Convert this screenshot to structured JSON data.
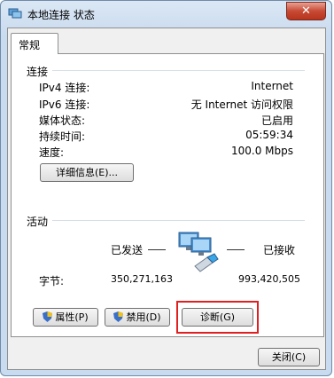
{
  "window": {
    "title": "本地连接 状态",
    "close_glyph": "✕"
  },
  "tabs": [
    {
      "label": "常规"
    }
  ],
  "connection": {
    "group_label": "连接",
    "rows": [
      {
        "label": "IPv4 连接:",
        "value": "Internet"
      },
      {
        "label": "IPv6 连接:",
        "value": "无 Internet 访问权限"
      },
      {
        "label": "媒体状态:",
        "value": "已启用"
      },
      {
        "label": "持续时间:",
        "value": "05:59:34"
      },
      {
        "label": "速度:",
        "value": "100.0 Mbps"
      }
    ],
    "details_button": "详细信息(E)..."
  },
  "activity": {
    "group_label": "活动",
    "sent_label": "已发送",
    "received_label": "已接收",
    "bytes_label": "字节:",
    "bytes_sent": "350,271,163",
    "bytes_received": "993,420,505"
  },
  "buttons": {
    "properties": "属性(P)",
    "disable": "禁用(D)",
    "diagnose": "诊断(G)",
    "close": "关闭(C)"
  }
}
